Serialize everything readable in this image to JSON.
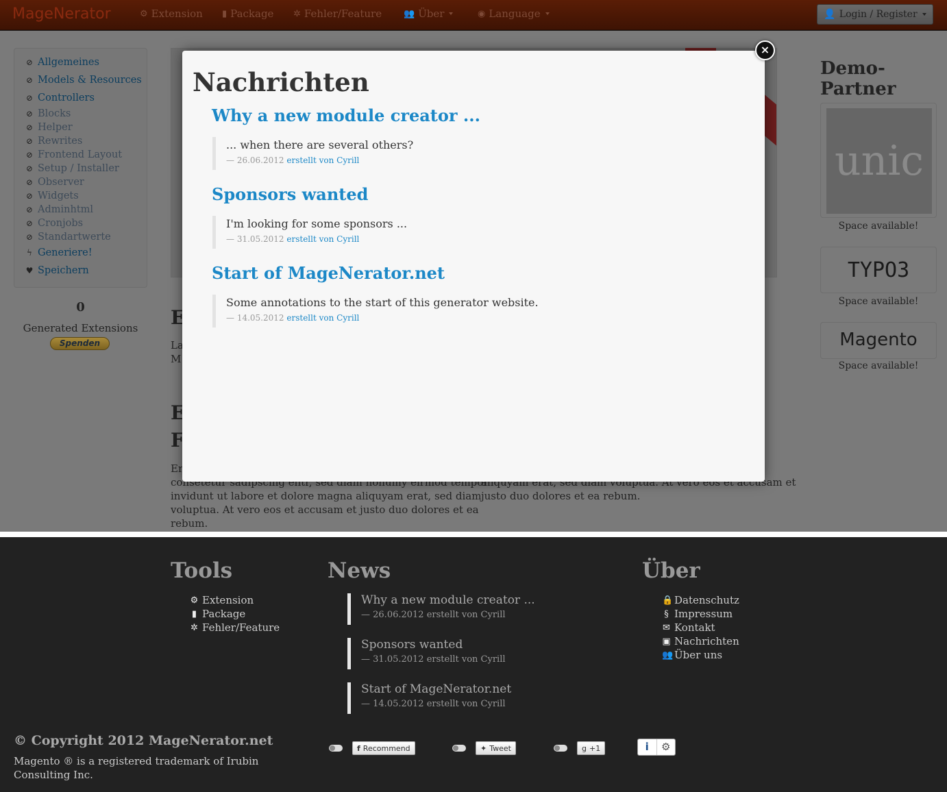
{
  "nav": {
    "brand": "MageNerator",
    "items": [
      {
        "label": "Extension",
        "icon": "gear-icon"
      },
      {
        "label": "Package",
        "icon": "book-icon"
      },
      {
        "label": "Fehler/Feature",
        "icon": "bug-icon"
      },
      {
        "label": "Über",
        "icon": "users-icon"
      },
      {
        "label": "Language",
        "icon": "globe-icon"
      }
    ],
    "login": "Login / Register"
  },
  "sidebar": {
    "items": [
      {
        "label": "Allgemeines",
        "state": "ok"
      },
      {
        "label": "Models & Resources",
        "state": "ok"
      },
      {
        "label": "Controllers",
        "state": "ok"
      },
      {
        "label": "Blocks",
        "state": "off"
      },
      {
        "label": "Helper",
        "state": "off"
      },
      {
        "label": "Rewrites",
        "state": "off"
      },
      {
        "label": "Frontend Layout",
        "state": "off"
      },
      {
        "label": "Setup / Installer",
        "state": "off"
      },
      {
        "label": "Observer",
        "state": "off"
      },
      {
        "label": "Widgets",
        "state": "off"
      },
      {
        "label": "Adminhtml",
        "state": "off"
      },
      {
        "label": "Cronjobs",
        "state": "off"
      },
      {
        "label": "Standartwerte",
        "state": "off"
      },
      {
        "label": "Generiere!",
        "state": "action"
      },
      {
        "label": "Speichern",
        "state": "action"
      }
    ],
    "counter": "0",
    "counter_label": "Generated Extensions",
    "donate": "Spenden"
  },
  "background": {
    "h1": "E",
    "p1a": "La",
    "p1b": "M",
    "h2a": "E",
    "h2b": "F",
    "left_text": [
      "Er",
      "consetetur sadipscing elitr, sed diam nonumy eirmod tempor",
      "invidunt ut labore et dolore magna aliquyam erat, sed diam",
      "voluptua. At vero eos et accusam et justo duo dolores et ea",
      "rebum."
    ],
    "right_text": [
      "aliquyam erat, sed diam voluptua. At vero eos et accusam et",
      "justo duo dolores et ea rebum."
    ]
  },
  "partners": {
    "title": "Demo-Partner",
    "logos": [
      "unic",
      "TYPO3",
      "Magento"
    ],
    "label": "Space available!"
  },
  "modal": {
    "title": "Nachrichten",
    "close": "×",
    "news": [
      {
        "title": "Why a new module creator ...",
        "teaser": "... when there are several others?",
        "date": "26.06.2012",
        "by": "erstellt von Cyrill"
      },
      {
        "title": "Sponsors wanted",
        "teaser": "I'm looking for some sponsors ...",
        "date": "31.05.2012",
        "by": "erstellt von Cyrill"
      },
      {
        "title": "Start of MageNerator.net",
        "teaser": "Some annotations to the start of this generator website.",
        "date": "14.05.2012",
        "by": "erstellt von Cyrill"
      }
    ]
  },
  "footer": {
    "tools_title": "Tools",
    "tools": [
      {
        "label": "Extension",
        "icon": "gear-icon"
      },
      {
        "label": "Package",
        "icon": "book-icon"
      },
      {
        "label": "Fehler/Feature",
        "icon": "bug-icon"
      }
    ],
    "news_title": "News",
    "news": [
      {
        "title": "Why a new module creator ...",
        "meta": "26.06.2012 erstellt von Cyrill"
      },
      {
        "title": "Sponsors wanted",
        "meta": "31.05.2012 erstellt von Cyrill"
      },
      {
        "title": "Start of MageNerator.net",
        "meta": "14.05.2012 erstellt von Cyrill"
      }
    ],
    "about_title": "Über",
    "about": [
      {
        "label": "Datenschutz",
        "icon": "lock-icon"
      },
      {
        "label": "Impressum",
        "icon": "section-icon"
      },
      {
        "label": "Kontakt",
        "icon": "envelope-icon"
      },
      {
        "label": "Nachrichten",
        "icon": "inbox-icon"
      },
      {
        "label": "Über uns",
        "icon": "users-icon"
      }
    ],
    "copyright": "© Copyright 2012 MageNerator.net",
    "trademark": "Magento ® is a registered trademark of Irubin Consulting Inc.",
    "social": {
      "facebook": "Recommend",
      "twitter": "Tweet",
      "google": "+1"
    }
  }
}
